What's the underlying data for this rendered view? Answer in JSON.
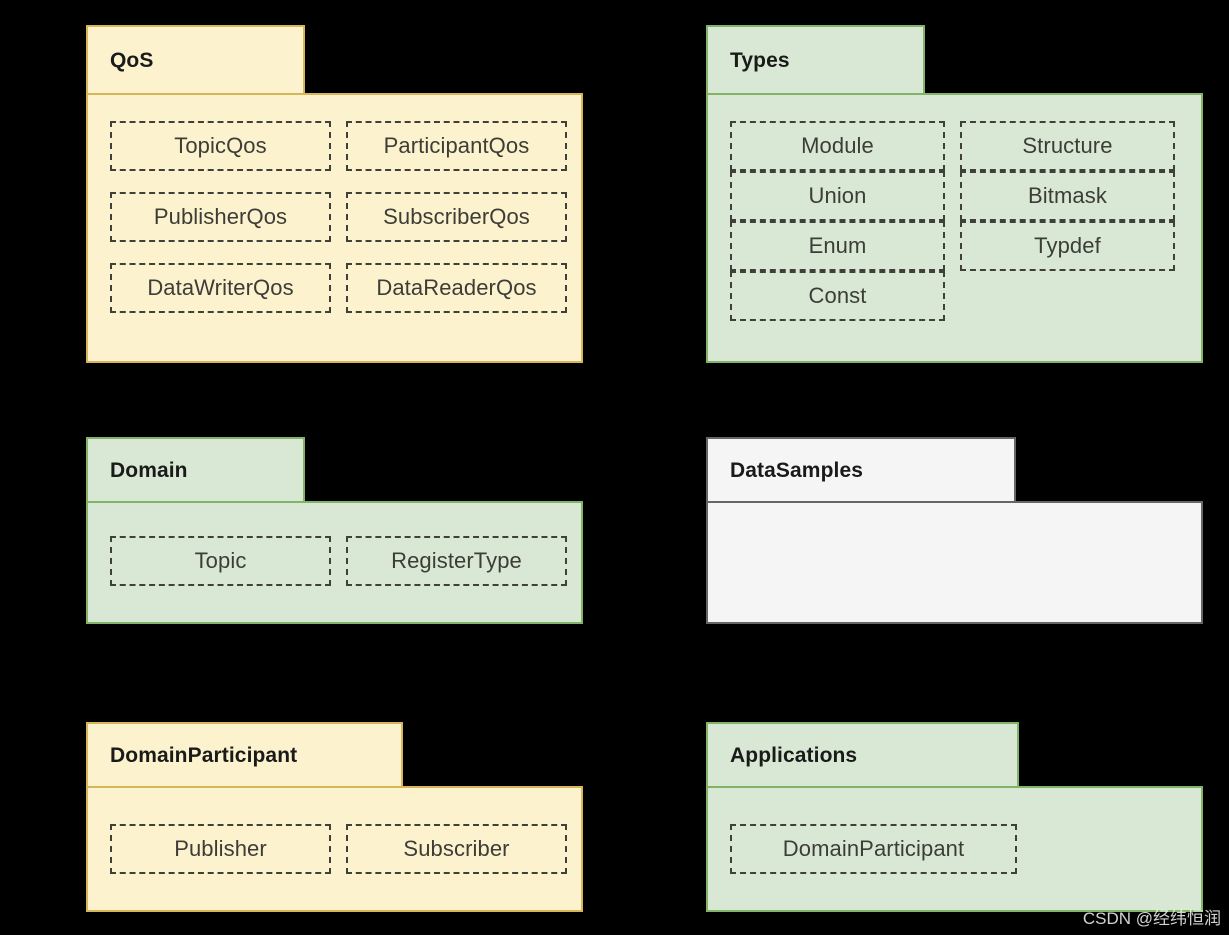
{
  "diagram": {
    "kind": "uml-package-diagram",
    "background_color": "#000000",
    "colors": {
      "yellow_fill": "#fcf2cd",
      "yellow_border": "#d6b656",
      "green_fill": "#d9e8d4",
      "green_border": "#82b366",
      "gray_fill": "#f5f5f5",
      "gray_border": "#666666",
      "dashed_border": "#40403a",
      "title_text": "#1a1a1a",
      "item_text": "#3d3d38"
    }
  },
  "packages": [
    {
      "id": "qos",
      "title": "QoS",
      "theme": "yellow",
      "columns": [
        [
          "TopicQos",
          "PublisherQos",
          "DataWriterQos"
        ],
        [
          "ParticipantQos",
          "SubscriberQos",
          "DataReaderQos"
        ]
      ]
    },
    {
      "id": "types",
      "title": "Types",
      "theme": "green",
      "columns": [
        [
          "Module",
          "Union",
          "Enum",
          "Const"
        ],
        [
          "Structure",
          "Bitmask",
          "Typdef"
        ]
      ]
    },
    {
      "id": "domain",
      "title": "Domain",
      "theme": "green",
      "columns": [
        [
          "Topic"
        ],
        [
          "RegisterType"
        ]
      ]
    },
    {
      "id": "datasamples",
      "title": "DataSamples",
      "theme": "gray",
      "columns": [
        [],
        []
      ]
    },
    {
      "id": "domainparticipant",
      "title": "DomainParticipant",
      "theme": "yellow",
      "columns": [
        [
          "Publisher"
        ],
        [
          "Subscriber"
        ]
      ]
    },
    {
      "id": "applications",
      "title": "Applications",
      "theme": "green",
      "columns": [
        [
          "DomainParticipant"
        ],
        []
      ]
    }
  ],
  "watermark": {
    "text": "CSDN @经纬恒润"
  }
}
